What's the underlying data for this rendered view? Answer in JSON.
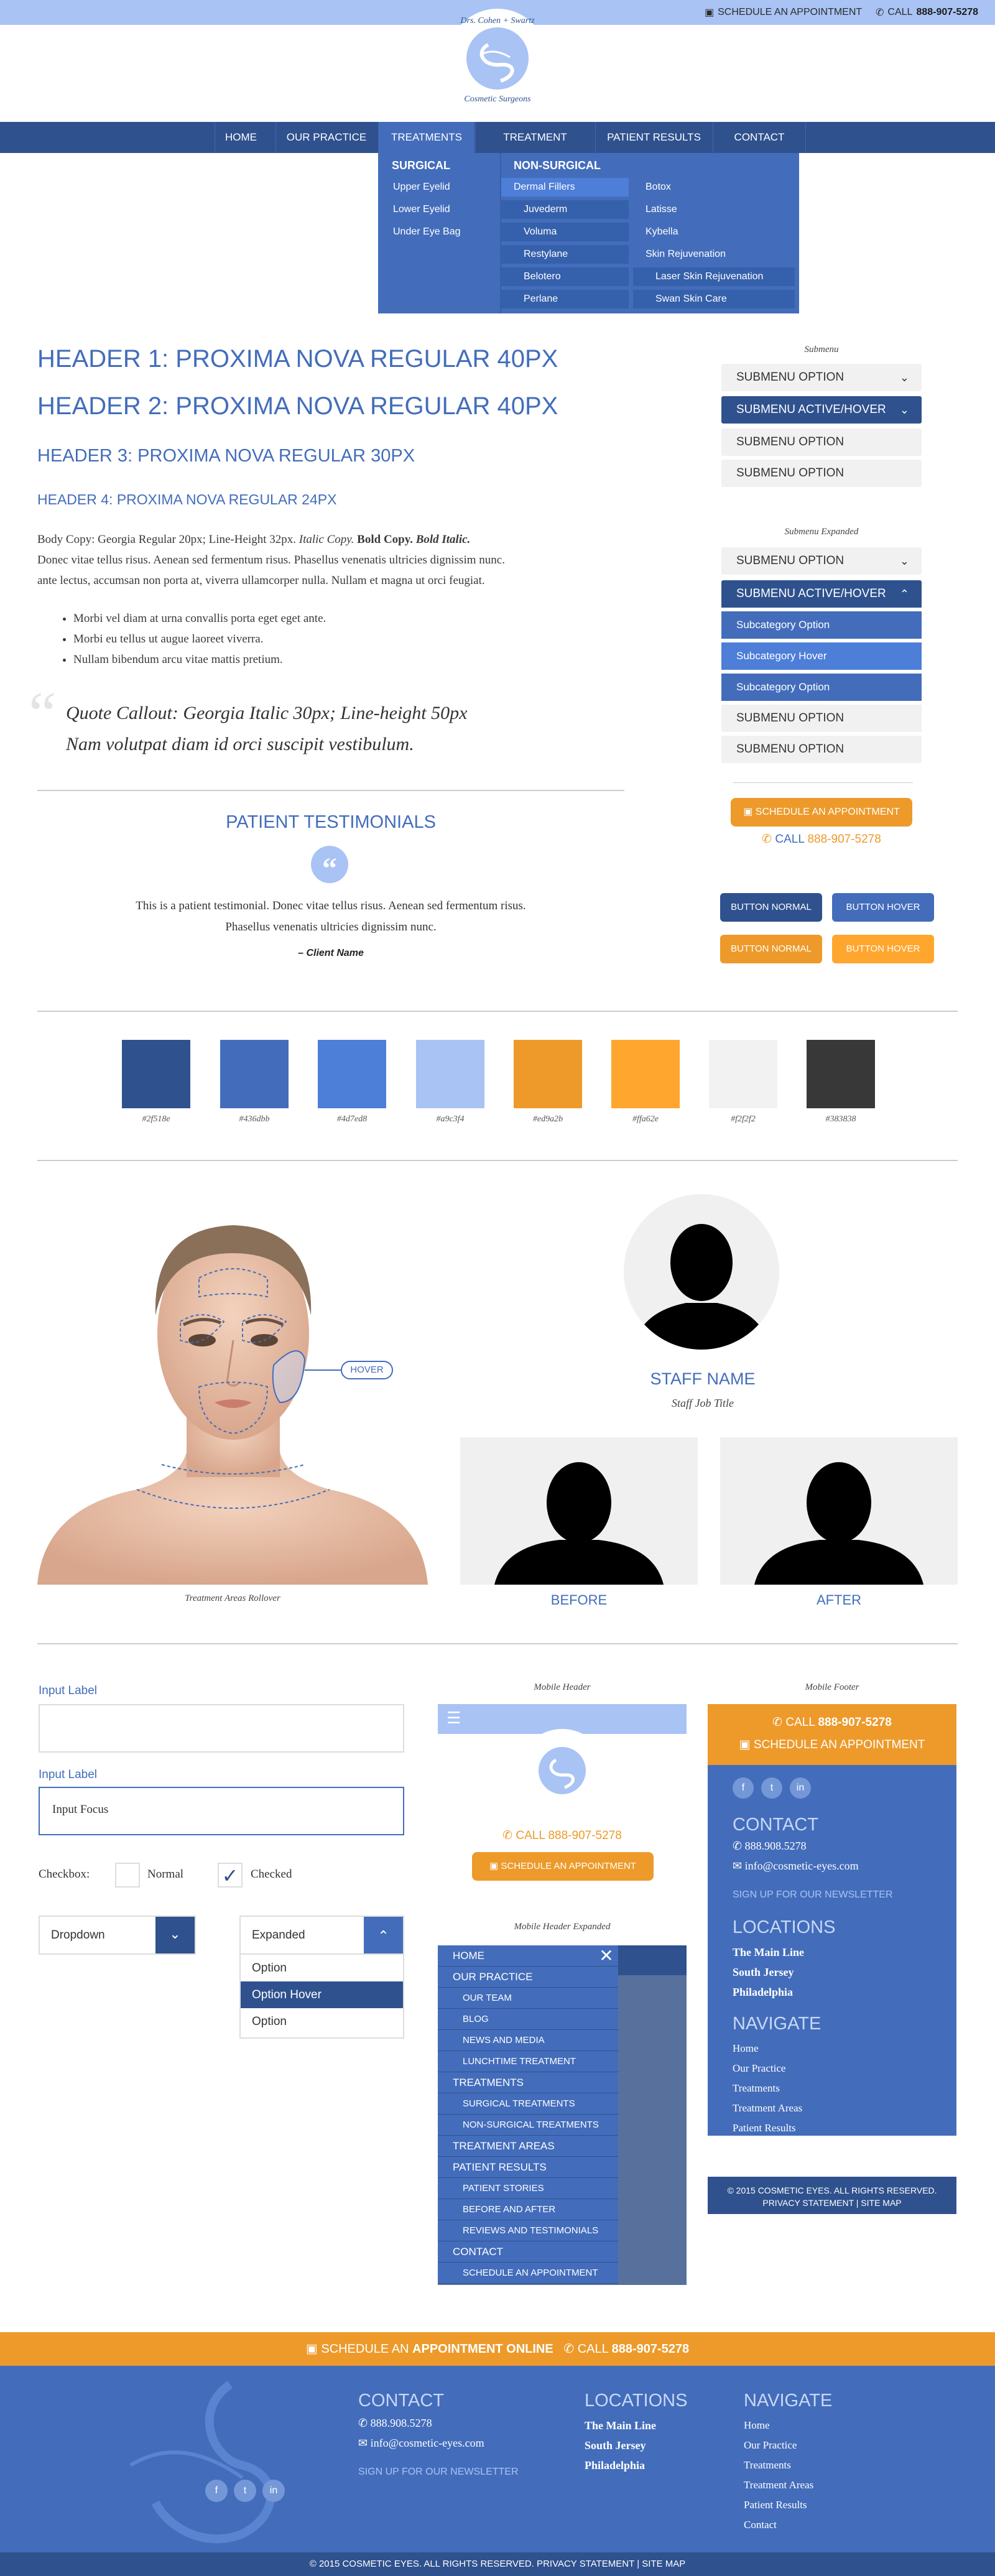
{
  "topbar": {
    "schedule": "SCHEDULE AN APPOINTMENT",
    "call": "CALL",
    "phone": "888-907-5278"
  },
  "logo": {
    "line1": "Drs. Cohen + Swartz",
    "line2": "Cosmetic Surgeons"
  },
  "nav": {
    "items": [
      "HOME",
      "OUR PRACTICE",
      "TREATMENTS",
      "TREATMENT AREAS",
      "PATIENT RESULTS",
      "CONTACT"
    ]
  },
  "mega": {
    "surgical_title": "SURGICAL",
    "surgical": [
      "Upper Eyelid",
      "Lower Eyelid",
      "Under Eye Bag"
    ],
    "nonsurgical_title": "NON-SURGICAL",
    "col2": [
      "Dermal Fillers",
      "Juvederm",
      "Voluma",
      "Restylane",
      "Belotero",
      "Perlane"
    ],
    "col3": [
      "Botox",
      "Latisse",
      "Kybella",
      "Skin Rejuvenation",
      "Laser Skin Rejuvenation",
      "Swan Skin Care"
    ]
  },
  "type": {
    "h1": "HEADER 1: PROXIMA NOVA REGULAR 40PX",
    "h2": "HEADER 2: PROXIMA NOVA REGULAR 40PX",
    "h3": "HEADER 3: PROXIMA NOVA REGULAR 30PX",
    "h4": "HEADER 4: PROXIMA NOVA REGULAR 24PX",
    "body_a": "Body Copy: Georgia Regular 20px; Line-Height 32px.",
    "body_italic": "Italic Copy.",
    "body_bold": "Bold Copy.",
    "body_bolditalic": "Bold Italic.",
    "body_b": "Donec vitae tellus risus. Aenean sed fermentum risus. Phasellus venenatis ultricies dignissim nunc.",
    "body_c": "ante lectus, accumsan non porta at, viverra ullamcorper nulla. Nullam et magna ut orci feugiat.",
    "bullets": [
      "Morbi vel diam at urna convallis porta eget eget ante.",
      "Morbi eu tellus ut augue laoreet viverra.",
      "Nullam bibendum arcu vitae mattis pretium."
    ],
    "quote1": "Quote Callout: Georgia Italic 30px; Line-height 50px",
    "quote2": "Nam volutpat diam id orci suscipit vestibulum."
  },
  "testimonials": {
    "title": "PATIENT TESTIMONIALS",
    "text1": "This is a patient testimonial. Donec vitae tellus risus. Aenean sed fermentum risus.",
    "text2": "Phasellus venenatis ultricies dignissim nunc.",
    "author": "– Client Name"
  },
  "submenu": {
    "caption": "Submenu",
    "items": [
      "SUBMENU OPTION",
      "SUBMENU ACTIVE/HOVER",
      "SUBMENU OPTION",
      "SUBMENU OPTION"
    ],
    "expanded_caption": "Submenu Expanded",
    "expanded": [
      "SUBMENU OPTION",
      "SUBMENU ACTIVE/HOVER",
      "Subcategory Option",
      "Subcategory Hover",
      "Subcategory Option",
      "SUBMENU OPTION",
      "SUBMENU OPTION"
    ],
    "cta_schedule": "SCHEDULE AN APPOINTMENT",
    "cta_call": "CALL",
    "cta_phone": "888-907-5278"
  },
  "buttons": {
    "normal": "BUTTON NORMAL",
    "hover": "BUTTON HOVER"
  },
  "colors": [
    {
      "hex": "#2f518e",
      "label": "#2f518e"
    },
    {
      "hex": "#436dbb",
      "label": "#436dbb"
    },
    {
      "hex": "#4d7ed8",
      "label": "#4d7ed8"
    },
    {
      "hex": "#a9c3f4",
      "label": "#a9c3f4"
    },
    {
      "hex": "#ed9a2b",
      "label": "#ed9a2b"
    },
    {
      "hex": "#ffa62e",
      "label": "#ffa62e"
    },
    {
      "hex": "#f2f2f2",
      "label": "#f2f2f2"
    },
    {
      "hex": "#383838",
      "label": "#383838"
    }
  ],
  "face": {
    "hover": "HOVER",
    "caption": "Treatment Areas Rollover"
  },
  "staff": {
    "name": "STAFF NAME",
    "title": "Staff Job Title",
    "before": "BEFORE",
    "after": "AFTER"
  },
  "form": {
    "label1": "Input Label",
    "label2": "Input Label",
    "focus_value": "Input Focus",
    "checkbox_label": "Checkbox:",
    "normal": "Normal",
    "checked": "Checked",
    "dropdown": "Dropdown",
    "expanded": "Expanded",
    "options": [
      "Option",
      "Option Hover",
      "Option"
    ]
  },
  "mobile": {
    "header_caption": "Mobile Header",
    "call": "CALL",
    "phone": "888-907-5278",
    "schedule": "SCHEDULE AN APPOINTMENT",
    "expanded_caption": "Mobile Header Expanded",
    "menu": [
      {
        "label": "HOME",
        "sub": false
      },
      {
        "label": "OUR PRACTICE",
        "sub": false
      },
      {
        "label": "OUR TEAM",
        "sub": true
      },
      {
        "label": "BLOG",
        "sub": true
      },
      {
        "label": "NEWS AND MEDIA",
        "sub": true
      },
      {
        "label": "LUNCHTIME TREATMENT",
        "sub": true
      },
      {
        "label": "TREATMENTS",
        "sub": false
      },
      {
        "label": "SURGICAL TREATMENTS",
        "sub": true
      },
      {
        "label": "NON-SURGICAL TREATMENTS",
        "sub": true
      },
      {
        "label": "TREATMENT AREAS",
        "sub": false
      },
      {
        "label": "PATIENT RESULTS",
        "sub": false
      },
      {
        "label": "PATIENT STORIES",
        "sub": true
      },
      {
        "label": "BEFORE AND AFTER",
        "sub": true
      },
      {
        "label": "REVIEWS AND TESTIMONIALS",
        "sub": true
      },
      {
        "label": "CONTACT",
        "sub": false
      },
      {
        "label": "SCHEDULE AN APPOINTMENT",
        "sub": true
      }
    ],
    "footer_caption": "Mobile Footer",
    "footer_call": "CALL",
    "footer_phone": "888-907-5278",
    "footer_schedule": "SCHEDULE AN APPOINTMENT",
    "contact": "CONTACT",
    "tel": "888.908.5278",
    "email": "info@cosmetic-eyes.com",
    "newsletter": "SIGN UP FOR OUR NEWSLETTER",
    "locations": "LOCATIONS",
    "loc": [
      "The Main Line",
      "South Jersey",
      "Philadelphia"
    ],
    "navigate": "NAVIGATE",
    "nav": [
      "Home",
      "Our Practice",
      "Treatments",
      "Treatment Areas",
      "Patient Results",
      "Contact"
    ],
    "copy1": "© 2015 COSMETIC EYES. ALL RIGHTS RESERVED.",
    "copy2": "PRIVACY STATEMENT | SITE MAP"
  },
  "footer": {
    "bar_schedule": "SCHEDULE AN",
    "bar_appointment": "APPOINTMENT ONLINE",
    "bar_call": "CALL",
    "bar_phone": "888-907-5278",
    "contact": "CONTACT",
    "tel": "888.908.5278",
    "email": "info@cosmetic-eyes.com",
    "newsletter": "SIGN UP FOR OUR NEWSLETTER",
    "locations": "LOCATIONS",
    "loc": [
      "The Main Line",
      "South Jersey",
      "Philadelphia"
    ],
    "navigate": "NAVIGATE",
    "nav": [
      "Home",
      "Our Practice",
      "Treatments",
      "Treatment Areas",
      "Patient Results",
      "Contact"
    ],
    "copyright": "© 2015 COSMETIC EYES. ALL RIGHTS RESERVED. PRIVACY STATEMENT | SITE MAP"
  }
}
